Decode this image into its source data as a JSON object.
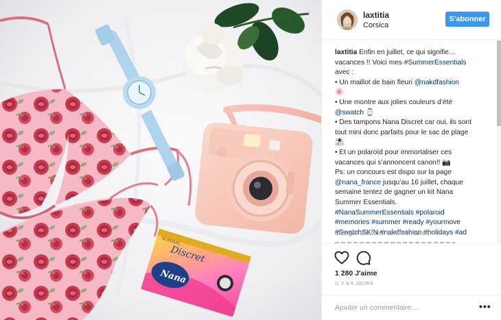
{
  "post": {
    "username": "laxtitia",
    "location": "Corsica",
    "follow_label": "S'abonner",
    "caption_user": "laxtitia",
    "caption_lines": [
      {
        "text": "Enfin en juillet, ce qui signifie…",
        "hashtag": ""
      },
      {
        "text": "vacances !! Voici mes ",
        "hashtag": "#SummerEssentials"
      },
      {
        "text": "avec :",
        "hashtag": ""
      },
      {
        "text": "• Un maillot de bain fleuri ",
        "hashtag": "@nakdfashion"
      },
      {
        "text": "🌸",
        "hashtag": ""
      },
      {
        "text": "• Une montre aux jolies couleurs d’été",
        "hashtag": ""
      },
      {
        "text": "",
        "hashtag": "@swatch ⌚"
      },
      {
        "text": "• Des tampons Nana Discret car oui, ils sont",
        "hashtag": ""
      },
      {
        "text": "tout mini donc parfaits pour le sac de plage",
        "hashtag": ""
      },
      {
        "text": "⛱",
        "hashtag": ""
      },
      {
        "text": "• Et un polaroïd pour immortaliser ces",
        "hashtag": ""
      },
      {
        "text": "vacances qui s’annoncent canon!! 📷",
        "hashtag": ""
      },
      {
        "text": "Ps: un concours est dispo sur la page",
        "hashtag": ""
      },
      {
        "text": "",
        "hashtag": "@nana_france",
        "after": " jusqu’au 16 juillet, chaque"
      },
      {
        "text": "semaine tentez de gagner un kit Nana",
        "hashtag": ""
      },
      {
        "text": "Summer Essentials.",
        "hashtag": ""
      },
      {
        "text": "",
        "hashtag": "#NanaSummerEssentials #polaroid"
      },
      {
        "text": "",
        "hashtag": "#memories #summer #ready #yourmove"
      },
      {
        "text": "",
        "hashtag": "#SwatchSKIN #nakdfashion #holidays #ad"
      }
    ],
    "load_more": "charger d'autres commentaires",
    "likes": "1 280 J'aime",
    "time": "IL Y A 5 JOURS",
    "comment_placeholder": "Ajouter un commentaire…",
    "more_label": "•••"
  },
  "photo": {
    "tampon_brand": "Nana",
    "tampon_product": "Discret",
    "tampon_maker": "NORMAL"
  },
  "colors": {
    "accent": "#3897f0",
    "link": "#003569",
    "muted": "#999999"
  },
  "icons": {
    "like": "heart-icon",
    "comment": "speech-bubble-icon",
    "more": "ellipsis-icon"
  }
}
